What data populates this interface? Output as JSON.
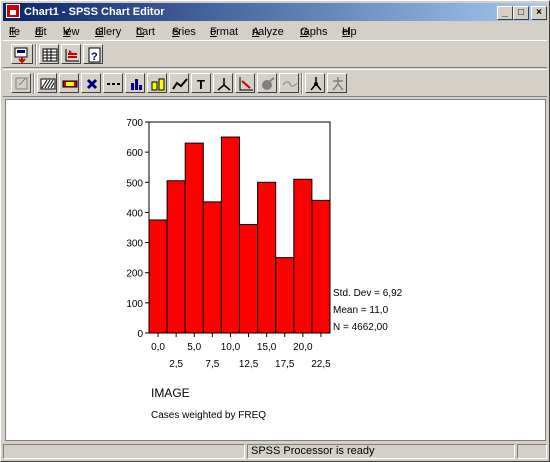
{
  "window": {
    "title": "Chart1 - SPSS Chart Editor",
    "buttons": {
      "minimize": "_",
      "maximize": "□",
      "close": "×"
    }
  },
  "menu": [
    {
      "label": "File",
      "accel": "F",
      "rest": "ile"
    },
    {
      "label": "Edit",
      "accel": "E",
      "rest": "dit"
    },
    {
      "label": "View",
      "accel": "V",
      "rest": "iew"
    },
    {
      "label": "Gallery",
      "accel": "G",
      "rest": "allery"
    },
    {
      "label": "Chart",
      "accel": "C",
      "rest": "hart"
    },
    {
      "label": "Series",
      "accel": "S",
      "rest": "eries"
    },
    {
      "label": "Format",
      "accel": "F",
      "rest": "ormat"
    },
    {
      "label": "Analyze",
      "accel": "A",
      "rest": "nalyze"
    },
    {
      "label": "Graphs",
      "accel": "G",
      "rest": "raphs"
    },
    {
      "label": "Help",
      "accel": "H",
      "rest": "elp"
    }
  ],
  "toolbar1": [
    "export-chart-icon",
    "data-editor-icon",
    "goto-case-icon",
    "help-icon"
  ],
  "toolbar2": [
    "point-id-icon",
    "fill-pattern-icon",
    "color-icon",
    "marker-icon",
    "line-style-icon",
    "bar-style-icon",
    "bar-label-icon",
    "interpolation-icon",
    "text-icon",
    "rotate-3d-icon",
    "swap-axes-icon",
    "explode-slice-icon",
    "break-line-icon",
    "spin-mode-icon",
    "spin-reset-icon"
  ],
  "status": {
    "text": "SPSS Processor  is ready"
  },
  "colors": {
    "bar": "#ff0000",
    "titlebar_start": "#0a246a",
    "titlebar_end": "#a6caf0"
  },
  "chart_data": {
    "type": "bar",
    "x": [
      0,
      2.5,
      5,
      7.5,
      10,
      12.5,
      15,
      17.5,
      20,
      22.5
    ],
    "values": [
      375,
      505,
      630,
      435,
      650,
      360,
      500,
      250,
      510,
      440
    ],
    "x_tick_labels_row1": [
      "0,0",
      "5,0",
      "10,0",
      "15,0",
      "20,0"
    ],
    "x_tick_labels_row2": [
      "2,5",
      "7,5",
      "12,5",
      "17,5",
      "22,5"
    ],
    "y_ticks": [
      0,
      100,
      200,
      300,
      400,
      500,
      600,
      700
    ],
    "ylim": [
      0,
      700
    ],
    "xlabel": "IMAGE",
    "ylabel": "",
    "stats": [
      "Std. Dev = 6,92",
      "Mean = 11,0",
      "N = 4662,00"
    ],
    "footnote": "Cases weighted by FREQ",
    "grid": false
  }
}
